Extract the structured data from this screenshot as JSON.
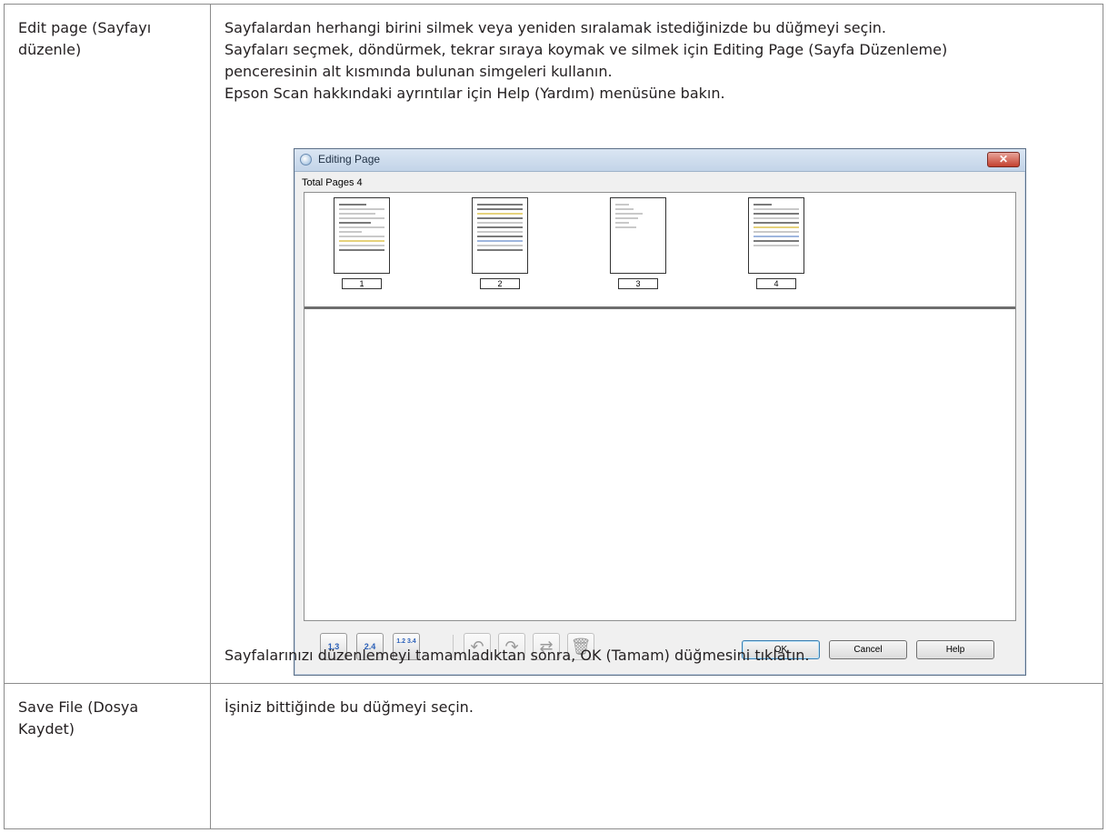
{
  "rows": [
    {
      "label": "Edit page (Sayfayı düzenle)",
      "label_lines": [
        "Edit page (Sayfayı",
        "düzenle)"
      ],
      "description": [
        "Sayfalardan herhangi birini silmek veya yeniden sıralamak istediğinizde bu düğmeyi seçin.",
        "Sayfaları seçmek, döndürmek, tekrar sıraya koymak ve silmek için Editing Page (Sayfa Düzenleme)",
        "penceresinin alt kısmında bulunan simgeleri kullanın.",
        "Epson Scan hakkındaki ayrıntılar için Help (Yardım) menüsüne bakın."
      ],
      "conclusion": "Sayfalarınızı düzenlemeyi tamamladıktan sonra, OK (Tamam) düğmesini tıklatın."
    },
    {
      "label": "Save File (Dosya Kaydet)",
      "label_lines": [
        "Save File (Dosya",
        "Kaydet)"
      ],
      "description": [
        "İşiniz bittiğinde bu düğmeyi seçin."
      ]
    }
  ],
  "dialog": {
    "title": "Editing Page",
    "total_pages": "Total Pages 4",
    "close_glyph": "✕",
    "pages": [
      "1",
      "2",
      "3",
      "4"
    ],
    "toolbar_icons": [
      {
        "name": "select-odd-pages-icon",
        "glyph": "1.3"
      },
      {
        "name": "select-even-pages-icon",
        "glyph": "2.4"
      },
      {
        "name": "select-all-pages-icon",
        "glyph": "1.2 3.4"
      },
      {
        "name": "rotate-left-icon",
        "glyph": "↶"
      },
      {
        "name": "rotate-right-icon",
        "glyph": "↷"
      },
      {
        "name": "reorder-pages-icon",
        "glyph": "⇄"
      },
      {
        "name": "delete-page-icon",
        "glyph": "🗑"
      }
    ],
    "buttons": {
      "ok": "OK",
      "cancel": "Cancel",
      "help": "Help"
    }
  }
}
